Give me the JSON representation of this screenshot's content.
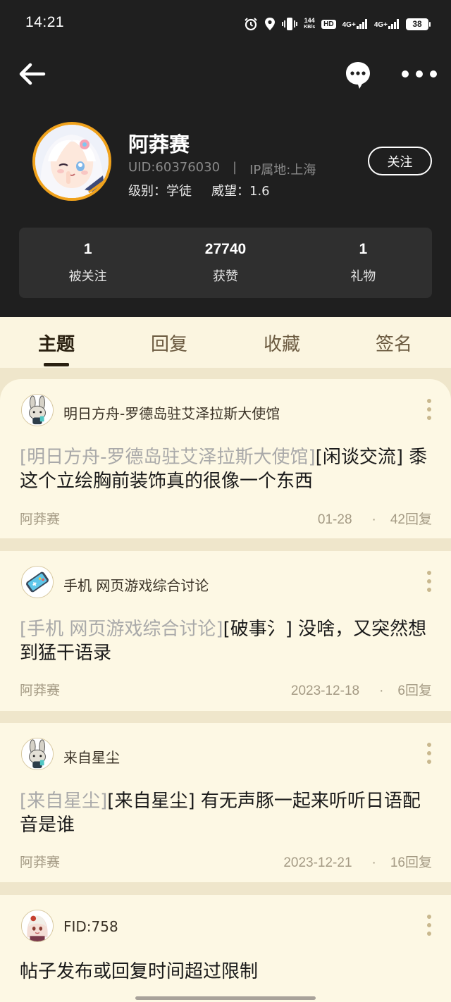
{
  "status_bar": {
    "time": "14:21",
    "net_speed_top": "144",
    "net_speed_bottom": "KB/s",
    "hd_label": "HD",
    "sig1_label": "4G+",
    "sig2_label": "4G+",
    "battery": "38",
    "icons": [
      "alarm-icon",
      "location-icon",
      "vibrate-icon",
      "hd-icon",
      "signal-icon",
      "signal-icon",
      "battery-icon"
    ]
  },
  "nav": {
    "icons": [
      "back-arrow-icon",
      "message-icon",
      "more-icon"
    ]
  },
  "profile": {
    "name": "阿莽赛",
    "uid": "UID:60376030",
    "sep": "|",
    "ip": "IP属地:上海",
    "level_label": "级别：学徒",
    "reputation_label": "威望：1.6",
    "follow_label": "关注",
    "accent_color": "#f0a21c"
  },
  "stats": [
    {
      "value": "1",
      "label": "被关注"
    },
    {
      "value": "27740",
      "label": "获赞"
    },
    {
      "value": "1",
      "label": "礼物"
    }
  ],
  "tabs": [
    {
      "label": "主题",
      "active": true
    },
    {
      "label": "回复",
      "active": false
    },
    {
      "label": "收藏",
      "active": false
    },
    {
      "label": "签名",
      "active": false
    }
  ],
  "posts": [
    {
      "forum": "明日方舟-罗德岛驻艾泽拉斯大使馆",
      "tag": "[明日方舟-罗德岛驻艾泽拉斯大使馆]",
      "title": "[闲谈交流]  黍这个立绘胸前装饰真的很像一个东西",
      "author": "阿莽赛",
      "date": "01-28",
      "dot": "·",
      "replies": "42回复"
    },
    {
      "forum": "手机  网页游戏综合讨论",
      "tag": "[手机  网页游戏综合讨论]",
      "title": "[破事氵]  没啥，又突然想到猛干语录",
      "author": "阿莽赛",
      "date": "2023-12-18",
      "dot": "·",
      "replies": "6回复"
    },
    {
      "forum": "来自星尘",
      "tag": "[来自星尘]",
      "title": "[来自星尘]  有无声豚一起来听听日语配音是谁",
      "author": "阿莽赛",
      "date": "2023-12-21",
      "dot": "·",
      "replies": "16回复"
    },
    {
      "forum": "FID:758",
      "title": "帖子发布或回复时间超过限制"
    }
  ]
}
